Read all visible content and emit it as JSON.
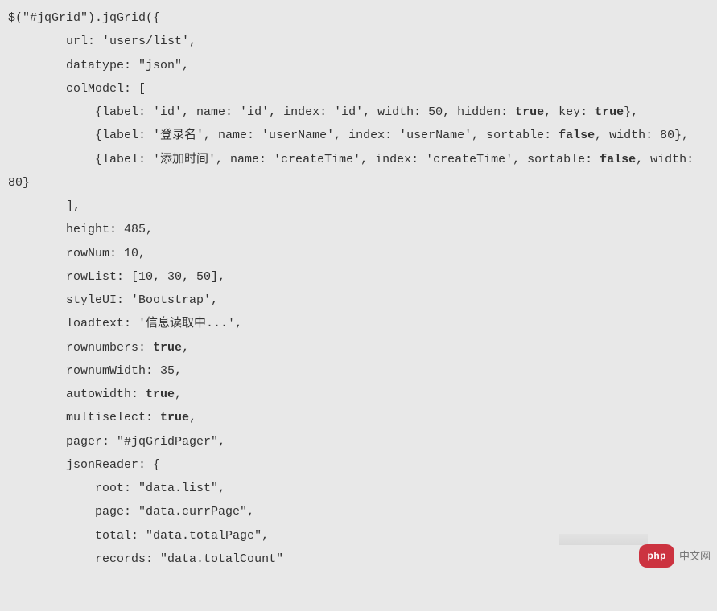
{
  "code": {
    "l1": "$(\"#jqGrid\").jqGrid({",
    "l2": "        url: 'users/list',",
    "l3": "        datatype: \"json\",",
    "l4": "        colModel: [",
    "l5a": "            {label: 'id', name: 'id', index: 'id', width: 50, hidden: ",
    "l5b": "true",
    "l5c": ", key: ",
    "l5d": "true",
    "l5e": "},",
    "l6a": "            {label: '登录名', name: 'userName', index: 'userName', sortable: ",
    "l6b": "false",
    "l6c": ", width: 80},",
    "l7a": "            {label: '添加时间', name: 'createTime', index: 'createTime', sortable: ",
    "l7b": "false",
    "l7c": ", width: 80}",
    "l8": "        ],",
    "l9": "        height: 485,",
    "l10": "        rowNum: 10,",
    "l11": "        rowList: [10, 30, 50],",
    "l12": "        styleUI: 'Bootstrap',",
    "l13": "        loadtext: '信息读取中...',",
    "l14a": "        rownumbers: ",
    "l14b": "true",
    "l14c": ",",
    "l15": "        rownumWidth: 35,",
    "l16a": "        autowidth: ",
    "l16b": "true",
    "l16c": ",",
    "l17a": "        multiselect: ",
    "l17b": "true",
    "l17c": ",",
    "l18": "        pager: \"#jqGridPager\",",
    "l19": "        jsonReader: {",
    "l20": "            root: \"data.list\",",
    "l21": "            page: \"data.currPage\",",
    "l22": "            total: \"data.totalPage\",",
    "l23": "            records: \"data.totalCount\""
  },
  "watermark": {
    "pill": "php",
    "text": "中文网"
  }
}
